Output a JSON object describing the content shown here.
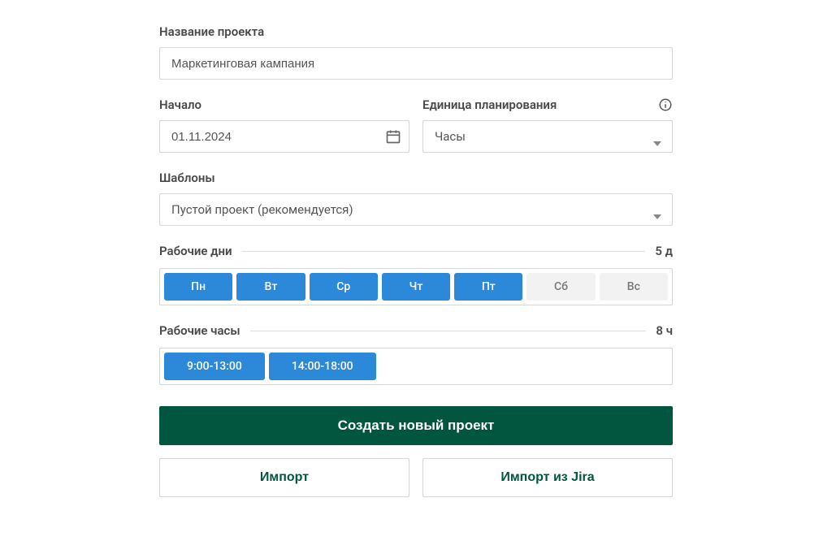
{
  "projectName": {
    "label": "Название проекта",
    "value": "Маркетинговая кампания"
  },
  "startDate": {
    "label": "Начало",
    "value": "01.11.2024"
  },
  "planningUnit": {
    "label": "Единица планирования",
    "value": "Часы"
  },
  "templates": {
    "label": "Шаблоны",
    "value": "Пустой проект (рекомендуется)"
  },
  "workingDays": {
    "label": "Рабочие дни",
    "summary": "5 д",
    "days": [
      {
        "label": "Пн",
        "active": true
      },
      {
        "label": "Вт",
        "active": true
      },
      {
        "label": "Ср",
        "active": true
      },
      {
        "label": "Чт",
        "active": true
      },
      {
        "label": "Пт",
        "active": true
      },
      {
        "label": "Сб",
        "active": false
      },
      {
        "label": "Вс",
        "active": false
      }
    ]
  },
  "workingHours": {
    "label": "Рабочие часы",
    "summary": "8 ч",
    "ranges": [
      "9:00-13:00",
      "14:00-18:00"
    ]
  },
  "actions": {
    "create": "Создать новый проект",
    "import": "Импорт",
    "importJira": "Импорт из Jira"
  }
}
